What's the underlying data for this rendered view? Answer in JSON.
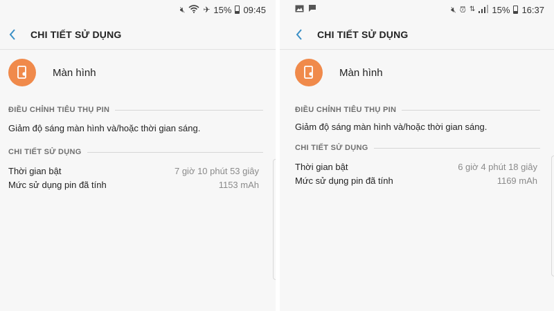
{
  "screens": [
    {
      "status": {
        "percent": "15%",
        "time": "09:45"
      },
      "title": "CHI TIẾT SỬ DỤNG",
      "app_name": "Màn hình",
      "section1": {
        "header": "ĐIỀU CHỈNH TIÊU THỤ PIN",
        "tip": "Giảm độ sáng màn hình và/hoặc thời gian sáng."
      },
      "section2": {
        "header": "CHI TIẾT SỬ DỤNG",
        "rows": [
          {
            "label": "Thời gian bật",
            "value": "7 giờ 10 phút 53 giây"
          },
          {
            "label": "Mức sử dụng pin đã tính",
            "value": "1153 mAh"
          }
        ]
      }
    },
    {
      "status": {
        "percent": "15%",
        "time": "16:37"
      },
      "title": "CHI TIẾT SỬ DỤNG",
      "app_name": "Màn hình",
      "section1": {
        "header": "ĐIỀU CHỈNH TIÊU THỤ PIN",
        "tip": "Giảm độ sáng màn hình và/hoặc thời gian sáng."
      },
      "section2": {
        "header": "CHI TIẾT SỬ DỤNG",
        "rows": [
          {
            "label": "Thời gian bật",
            "value": "6 giờ 4 phút 18 giây"
          },
          {
            "label": "Mức sử dụng pin đã tính",
            "value": "1169 mAh"
          }
        ]
      }
    }
  ],
  "colors": {
    "accent": "#3a8fc6",
    "app_icon": "#f08a4b",
    "background": "#f7f7f7"
  },
  "icons": {
    "left_status": [
      "mute-icon",
      "wifi-icon",
      "airplane-icon",
      "battery-icon"
    ],
    "right_status": [
      "gallery-icon",
      "message-icon",
      "mute-icon",
      "alarm-icon",
      "data-icon",
      "signal-icon",
      "battery-icon"
    ],
    "app": "screen-brightness-icon",
    "back": "back-arrow-icon"
  }
}
